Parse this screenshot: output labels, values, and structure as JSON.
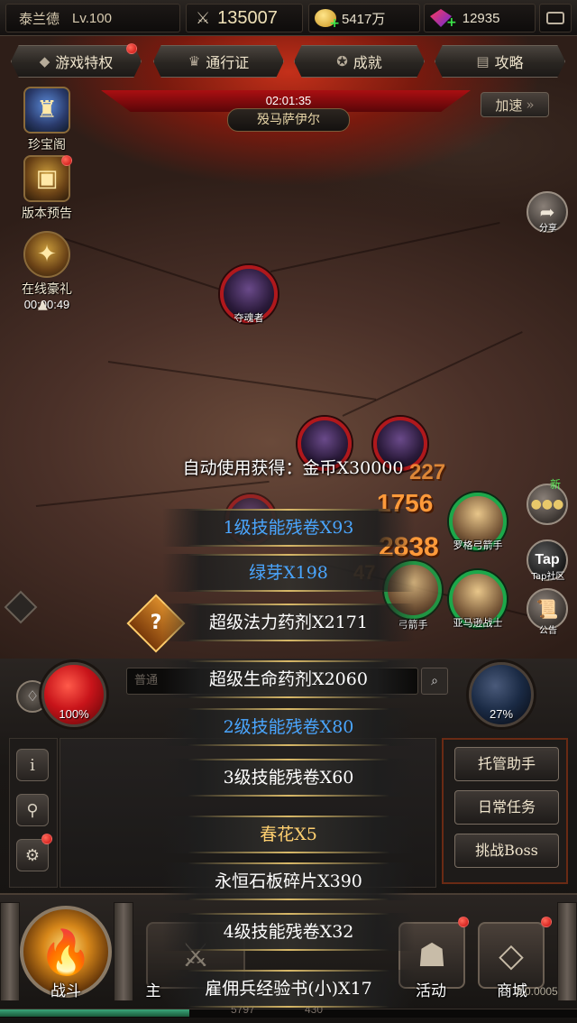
{
  "topbar": {
    "player_name": "泰兰德",
    "level": "Lv.100",
    "power": "135007",
    "gold": "5417万",
    "gems": "12935"
  },
  "tabs": [
    {
      "label": "游戏特权",
      "icon": "diamond-icon",
      "has_dot": true
    },
    {
      "label": "通行证",
      "icon": "crown-icon",
      "has_dot": false
    },
    {
      "label": "成就",
      "icon": "badge-icon",
      "has_dot": false
    },
    {
      "label": "攻略",
      "icon": "book-icon",
      "has_dot": false
    }
  ],
  "boss": {
    "timer": "02:01:35",
    "name": "殁马萨伊尔",
    "speed_label": "加速"
  },
  "side_left": [
    {
      "label": "珍宝阁",
      "icon": "treasure-icon"
    },
    {
      "label": "版本预告",
      "icon": "chest-icon"
    },
    {
      "label": "在线豪礼",
      "icon": "gift-icon",
      "timer": "00:00:49"
    }
  ],
  "side_right": {
    "share_label": "分享",
    "chat_badge": "新",
    "tap_text": "Tap",
    "tap_label": "Tap社区",
    "notice_label": "公告"
  },
  "units": {
    "enemy_top": "夺魂者",
    "ally_1": "罗格弓箭手",
    "ally_2": "亚马逊战士",
    "mid_label": "弓箭手"
  },
  "damage_numbers": [
    "1756",
    "2838",
    "227",
    "47"
  ],
  "loot": {
    "header": "自动使用获得：金币X30000",
    "items": [
      {
        "text": "1级技能残卷X93",
        "quality": "blue"
      },
      {
        "text": "绿芽X198",
        "quality": "blue"
      },
      {
        "text": "超级法力药剂X2171",
        "quality": "white"
      },
      {
        "text": "超级生命药剂X2060",
        "quality": "white"
      },
      {
        "text": "2级技能残卷X80",
        "quality": "blue"
      },
      {
        "text": "3级技能残卷X60",
        "quality": "white"
      },
      {
        "text": "春花X5",
        "quality": "gold"
      },
      {
        "text": "永恒石板碎片X390",
        "quality": "white"
      },
      {
        "text": "4级技能残卷X32",
        "quality": "white"
      },
      {
        "text": "雇佣兵经验书(小)X17",
        "quality": "white"
      }
    ]
  },
  "hud": {
    "hp_percent": "100%",
    "mp_percent": "27%",
    "chat_placeholder": "普通"
  },
  "right_menu": [
    "托管助手",
    "日常任务",
    "挑战Boss"
  ],
  "bottom_nav": {
    "battle_label": "战斗",
    "main_label": "主",
    "activity_label": "活动",
    "shop_label": "商城"
  },
  "footer": {
    "version": "2.0.0005",
    "faded_a": "5797",
    "faded_b": "430"
  },
  "colors": {
    "quality_blue": "#4aa6ff",
    "quality_white": "#ffffff",
    "quality_gold": "#ffd070",
    "hp_orb": "#c8141a",
    "mp_orb": "#1a2a44",
    "badge_red": "#c80c0c"
  }
}
